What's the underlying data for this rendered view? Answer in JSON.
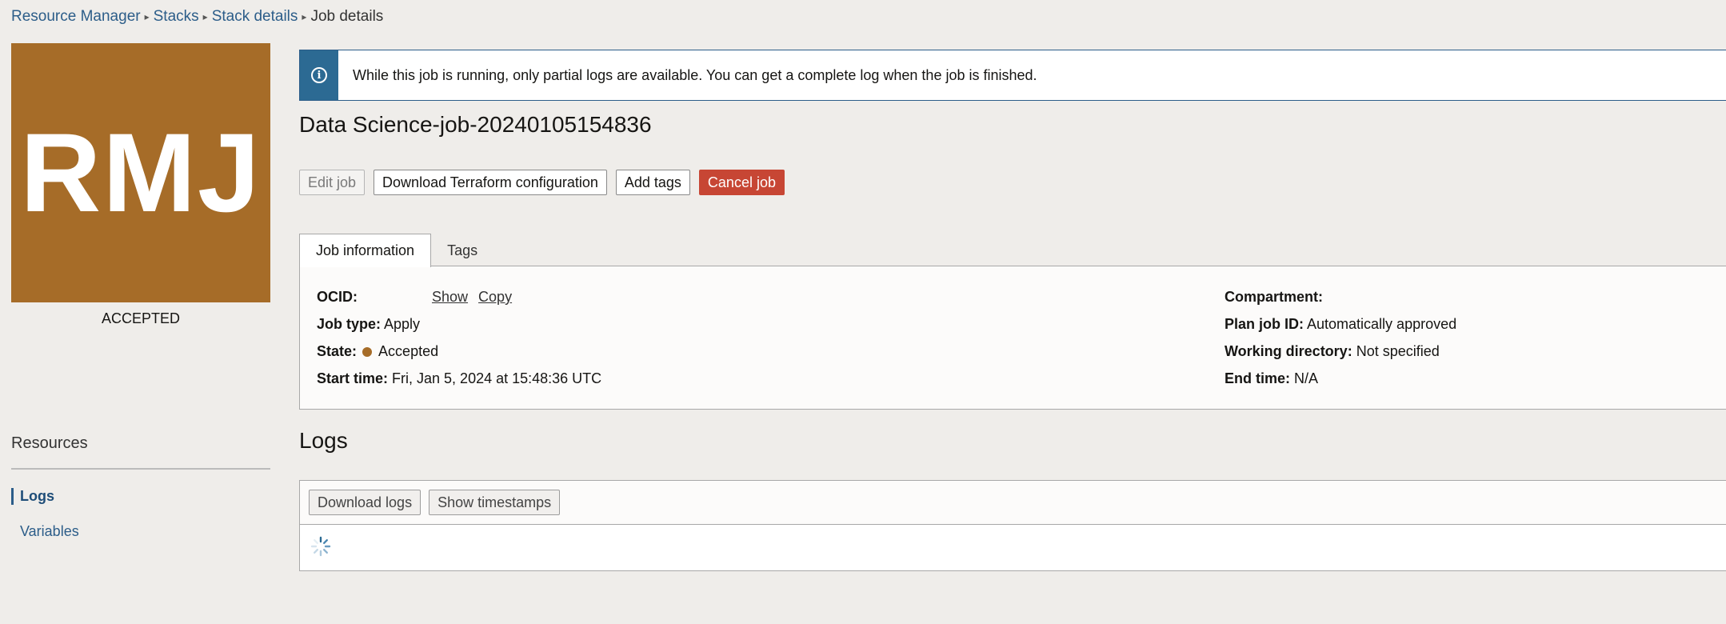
{
  "breadcrumb": {
    "items": [
      "Resource Manager",
      "Stacks",
      "Stack details"
    ],
    "current": "Job details"
  },
  "badge": {
    "initials": "RMJ",
    "status": "ACCEPTED",
    "color": "#a66c28"
  },
  "banner": {
    "message": "While this job is running, only partial logs are available. You can get a complete log when the job is finished."
  },
  "job": {
    "title": "Data Science-job-20240105154836"
  },
  "actions": {
    "edit": "Edit job",
    "download_tf": "Download Terraform configuration",
    "add_tags": "Add tags",
    "cancel": "Cancel job"
  },
  "tabs": {
    "job_info": "Job information",
    "tags": "Tags"
  },
  "info": {
    "ocid_label": "OCID:",
    "ocid_value": "",
    "show": "Show",
    "copy": "Copy",
    "job_type_label": "Job type:",
    "job_type": "Apply",
    "state_label": "State:",
    "state": "Accepted",
    "start_label": "Start time:",
    "start": "Fri, Jan 5, 2024 at 15:48:36 UTC",
    "compartment_label": "Compartment:",
    "compartment": "",
    "plan_label": "Plan job ID:",
    "plan": "Automatically approved",
    "workdir_label": "Working directory:",
    "workdir": "Not specified",
    "end_label": "End time:",
    "end": "N/A"
  },
  "resources": {
    "title": "Resources",
    "items": [
      "Logs",
      "Variables"
    ]
  },
  "logs": {
    "title": "Logs",
    "download": "Download logs",
    "timestamps": "Show timestamps"
  },
  "colors": {
    "accent": "#2c5d89",
    "danger": "#c74634",
    "badge": "#a66c28"
  }
}
